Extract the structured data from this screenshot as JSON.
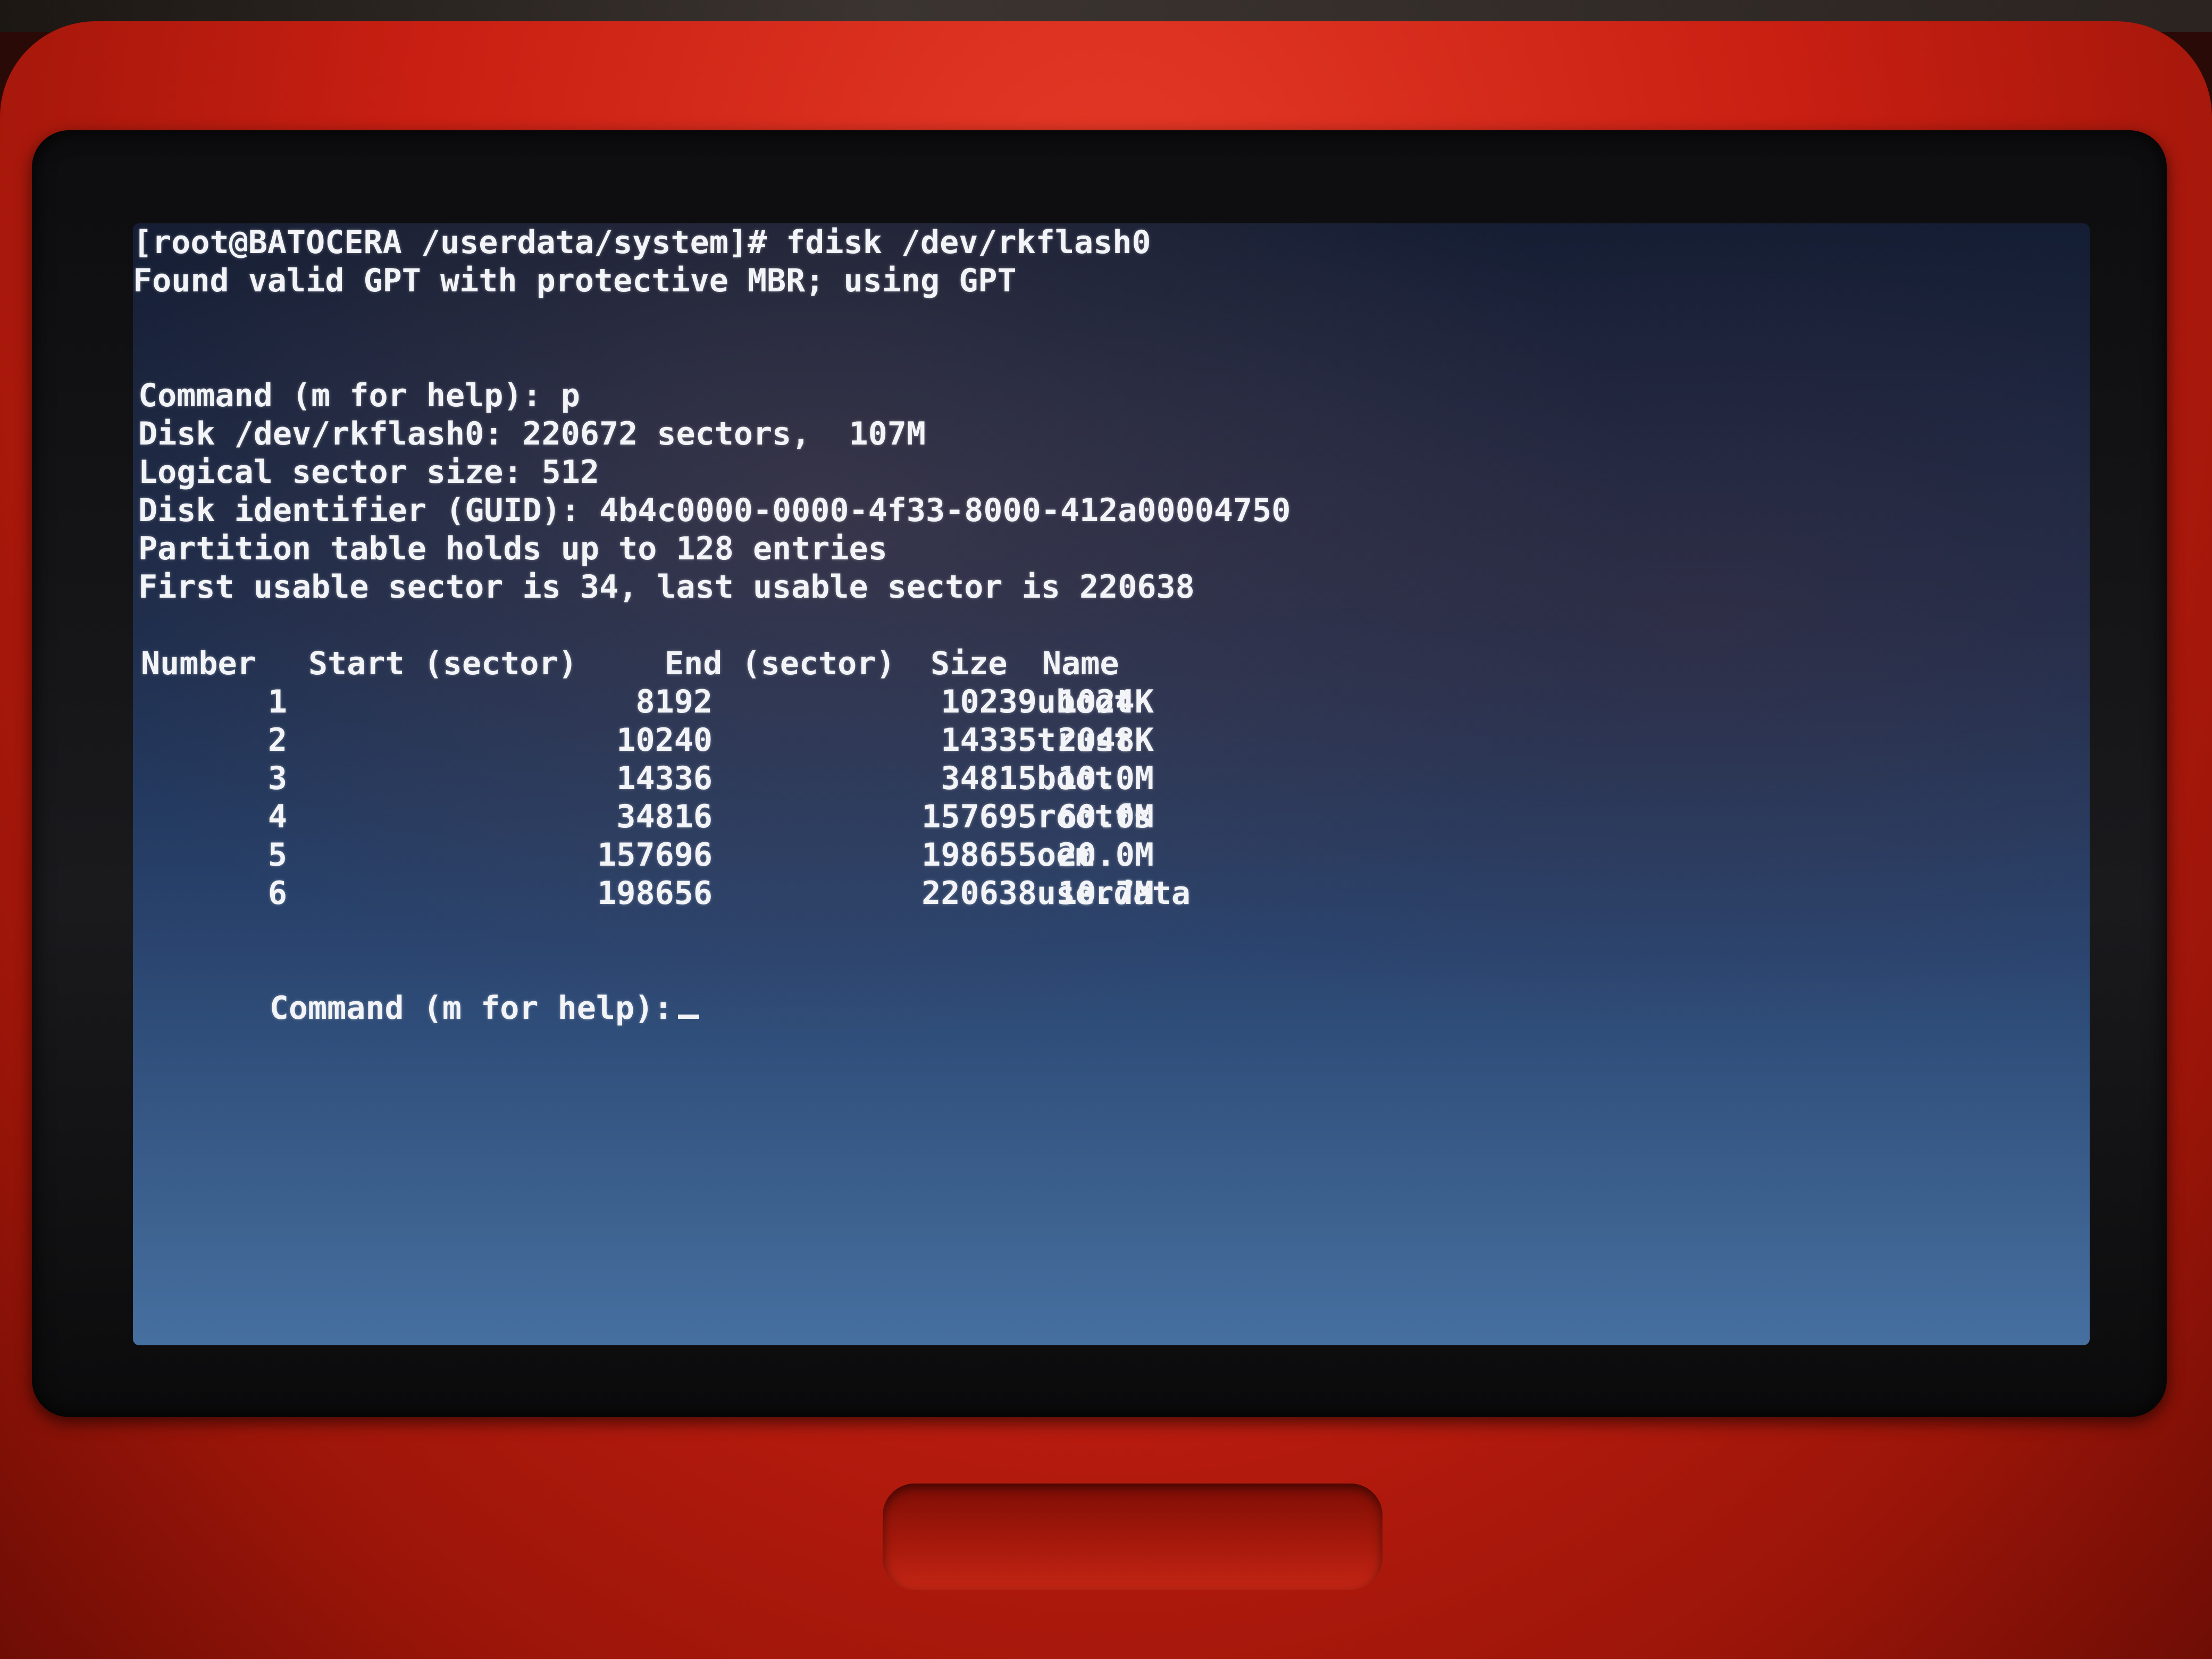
{
  "terminal": {
    "prompt_line": "[root@BATOCERA /userdata/system]# fdisk /dev/rkflash0",
    "gpt_notice": "Found valid GPT with protective MBR; using GPT",
    "command_p": "Command (m for help): p",
    "disk_info": "Disk /dev/rkflash0: 220672 sectors,  107M",
    "sector_size": "Logical sector size: 512",
    "disk_identifier": "Disk identifier (GUID): 4b4c0000-0000-4f33-8000-412a00004750",
    "partition_table": "Partition table holds up to 128 entries",
    "usable_sectors": "First usable sector is 34, last usable sector is 220638",
    "table_headers": {
      "number": "Number",
      "start": "Start (sector)",
      "end": "End (sector)",
      "size": "Size",
      "name": "Name"
    },
    "partitions": [
      {
        "number": "1",
        "start": "8192",
        "end": "10239",
        "size": "1024K",
        "name": "uboot"
      },
      {
        "number": "2",
        "start": "10240",
        "end": "14335",
        "size": "2048K",
        "name": "trust"
      },
      {
        "number": "3",
        "start": "14336",
        "end": "34815",
        "size": "10.0M",
        "name": "boot"
      },
      {
        "number": "4",
        "start": "34816",
        "end": "157695",
        "size": "60.0M",
        "name": "rootfs"
      },
      {
        "number": "5",
        "start": "157696",
        "end": "198655",
        "size": "20.0M",
        "name": "oem"
      },
      {
        "number": "6",
        "start": "198656",
        "end": "220638",
        "size": "10.7M",
        "name": "userdata"
      }
    ],
    "command_prompt": "Command (m for help):"
  }
}
